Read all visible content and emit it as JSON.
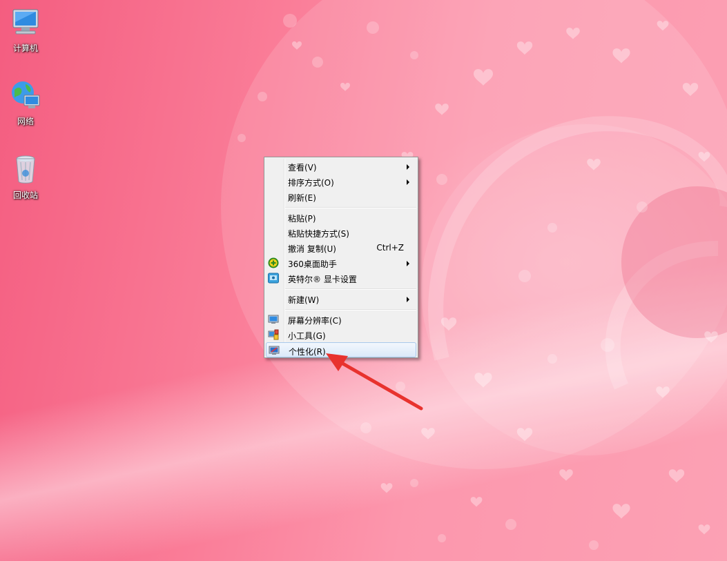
{
  "desktop": {
    "icons": [
      {
        "label": "计算机",
        "icon": "computer-icon"
      },
      {
        "label": "网络",
        "icon": "network-icon"
      },
      {
        "label": "回收站",
        "icon": "recycle-bin-icon"
      }
    ]
  },
  "context_menu": {
    "items": [
      {
        "label": "查看(V)",
        "submenu": true
      },
      {
        "label": "排序方式(O)",
        "submenu": true
      },
      {
        "label": "刷新(E)"
      },
      {
        "label": "粘贴(P)"
      },
      {
        "label": "粘贴快捷方式(S)"
      },
      {
        "label": "撤消 复制(U)",
        "shortcut": "Ctrl+Z"
      },
      {
        "label": "360桌面助手",
        "submenu": true,
        "icon": "360-desktop-assistant-icon"
      },
      {
        "label": "英特尔® 显卡设置",
        "icon": "intel-graphics-icon"
      },
      {
        "label": "新建(W)",
        "submenu": true
      },
      {
        "label": "屏幕分辨率(C)",
        "icon": "screen-resolution-icon"
      },
      {
        "label": "小工具(G)",
        "icon": "gadgets-icon"
      },
      {
        "label": "个性化(R)",
        "icon": "personalize-icon",
        "highlighted": true
      }
    ]
  },
  "colors": {
    "wallpaper_base": "#f45d80",
    "wallpaper_light": "#fca1b4",
    "menu_bg": "#f0f0f0",
    "highlight_border": "#a8c8ec",
    "annotation_arrow": "#e8322e"
  }
}
